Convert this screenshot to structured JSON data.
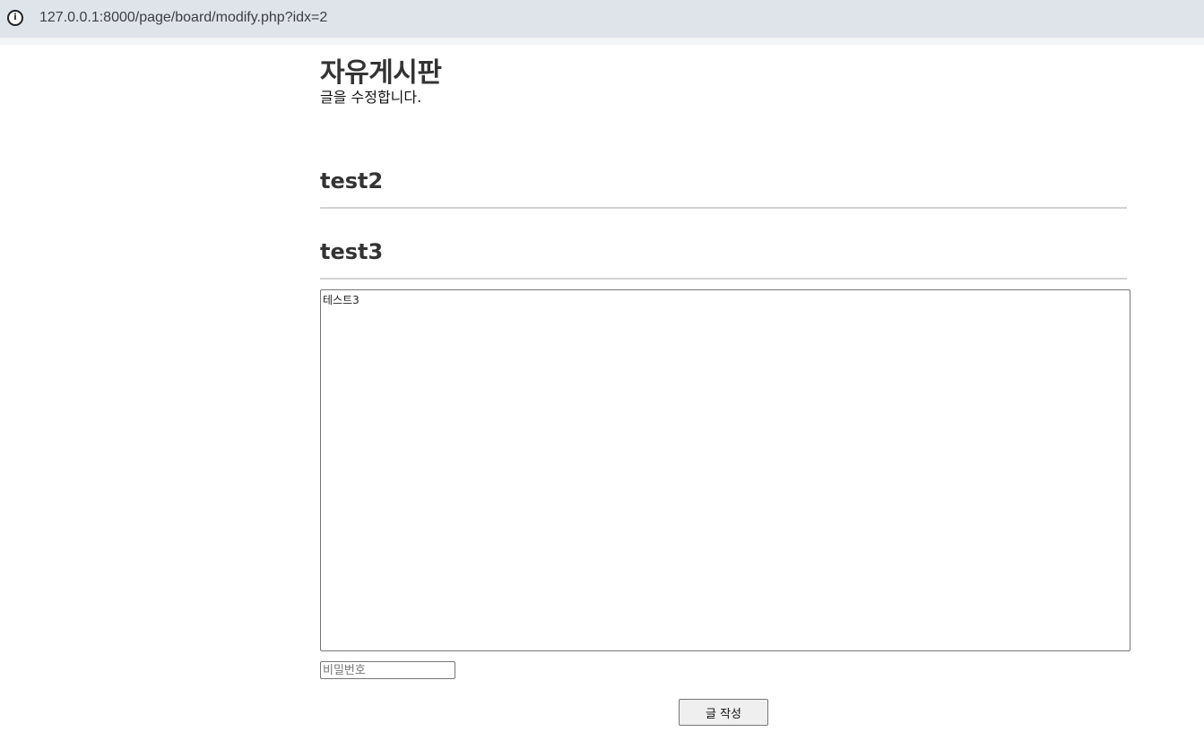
{
  "browser": {
    "url": "127.0.0.1:8000/page/board/modify.php?idx=2"
  },
  "board": {
    "title": "자유게시판",
    "subtitle": "글을 수정합니다."
  },
  "post": {
    "title": "test2",
    "subtitle": "test3",
    "body": "테스트3"
  },
  "form": {
    "password_placeholder": "비밀번호",
    "submit_label": "글 작성"
  }
}
